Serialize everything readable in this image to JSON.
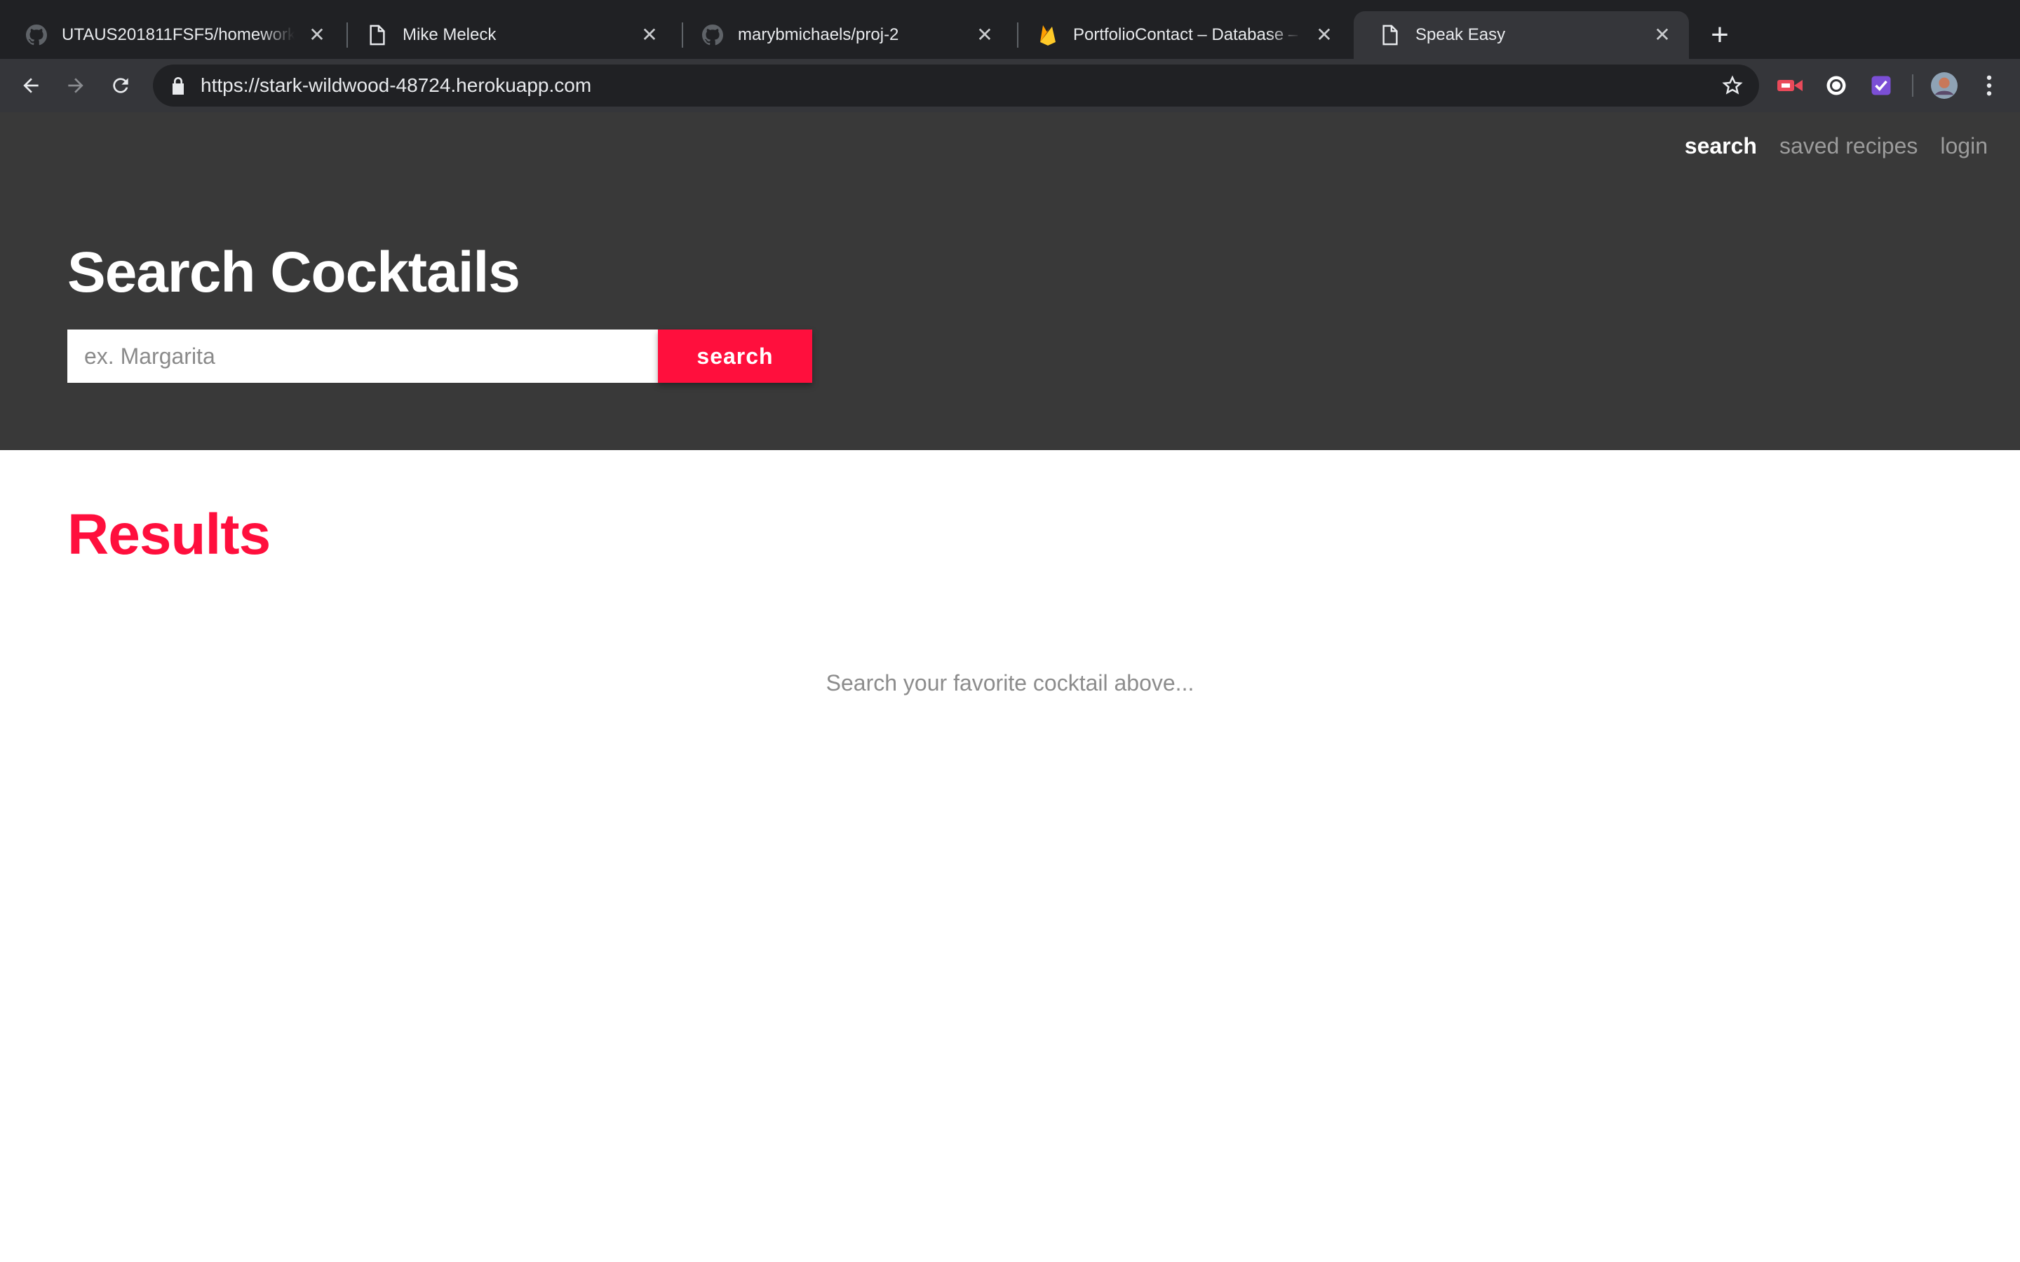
{
  "browser": {
    "tabs": [
      {
        "title": "UTAUS201811FSF5/homework-",
        "icon": "github-icon"
      },
      {
        "title": "Mike Meleck",
        "icon": "page-icon"
      },
      {
        "title": "marybmichaels/proj-2",
        "icon": "github-icon"
      },
      {
        "title": "PortfolioContact – Database – Fi",
        "icon": "firebase-icon"
      },
      {
        "title": "Speak Easy",
        "icon": "page-icon",
        "active": true
      }
    ],
    "url": "https://stark-wildwood-48724.herokuapp.com"
  },
  "site": {
    "nav": {
      "search": "search",
      "saved": "saved recipes",
      "login": "login"
    },
    "hero": {
      "title": "Search Cocktails",
      "input_placeholder": "ex. Margarita",
      "input_value": "",
      "button_label": "search"
    },
    "results": {
      "title": "Results",
      "empty_hint": "Search your favorite cocktail above..."
    }
  },
  "colors": {
    "accent": "#ff0f3d",
    "header_bg": "#393939",
    "chrome_dark": "#202124",
    "chrome_toolbar": "#35363a"
  }
}
